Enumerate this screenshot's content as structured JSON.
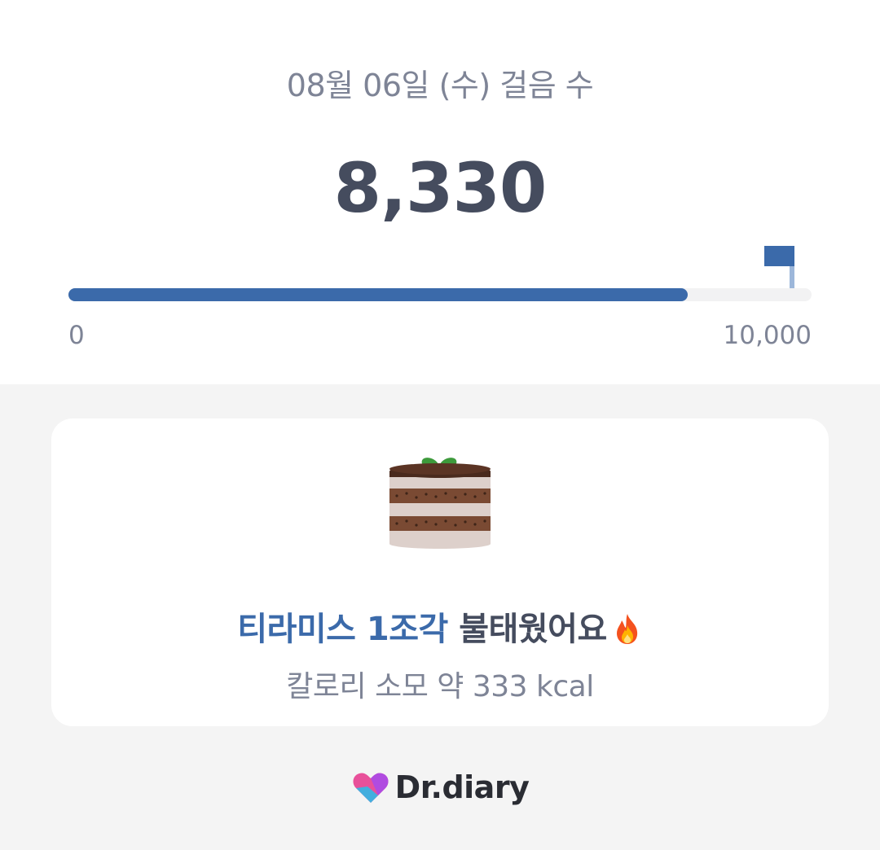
{
  "steps_panel": {
    "date_label": "08월 06일 (수) 걸음 수",
    "step_count": "8,330",
    "progress": {
      "value": 8330,
      "goal": 10000,
      "fraction": 0.833,
      "min_label": "0",
      "max_label": "10,000",
      "fill_color": "#3b6aaa"
    },
    "goal_icon": "flag-icon"
  },
  "calorie_card": {
    "icon": "tiramisu-cake-icon",
    "headline_highlight": "티라미스 1조각",
    "headline_rest": " 불태웠어요",
    "headline_emoji_icon": "fire-icon",
    "subtext": "칼로리 소모 약 333 kcal"
  },
  "footer": {
    "brand_name": "Dr.diary",
    "brand_icon": "heart-logo-icon"
  },
  "colors": {
    "accent": "#3b6aaa",
    "text_dark": "#454c5e",
    "text_muted": "#7e8496",
    "background": "#f4f4f4"
  }
}
